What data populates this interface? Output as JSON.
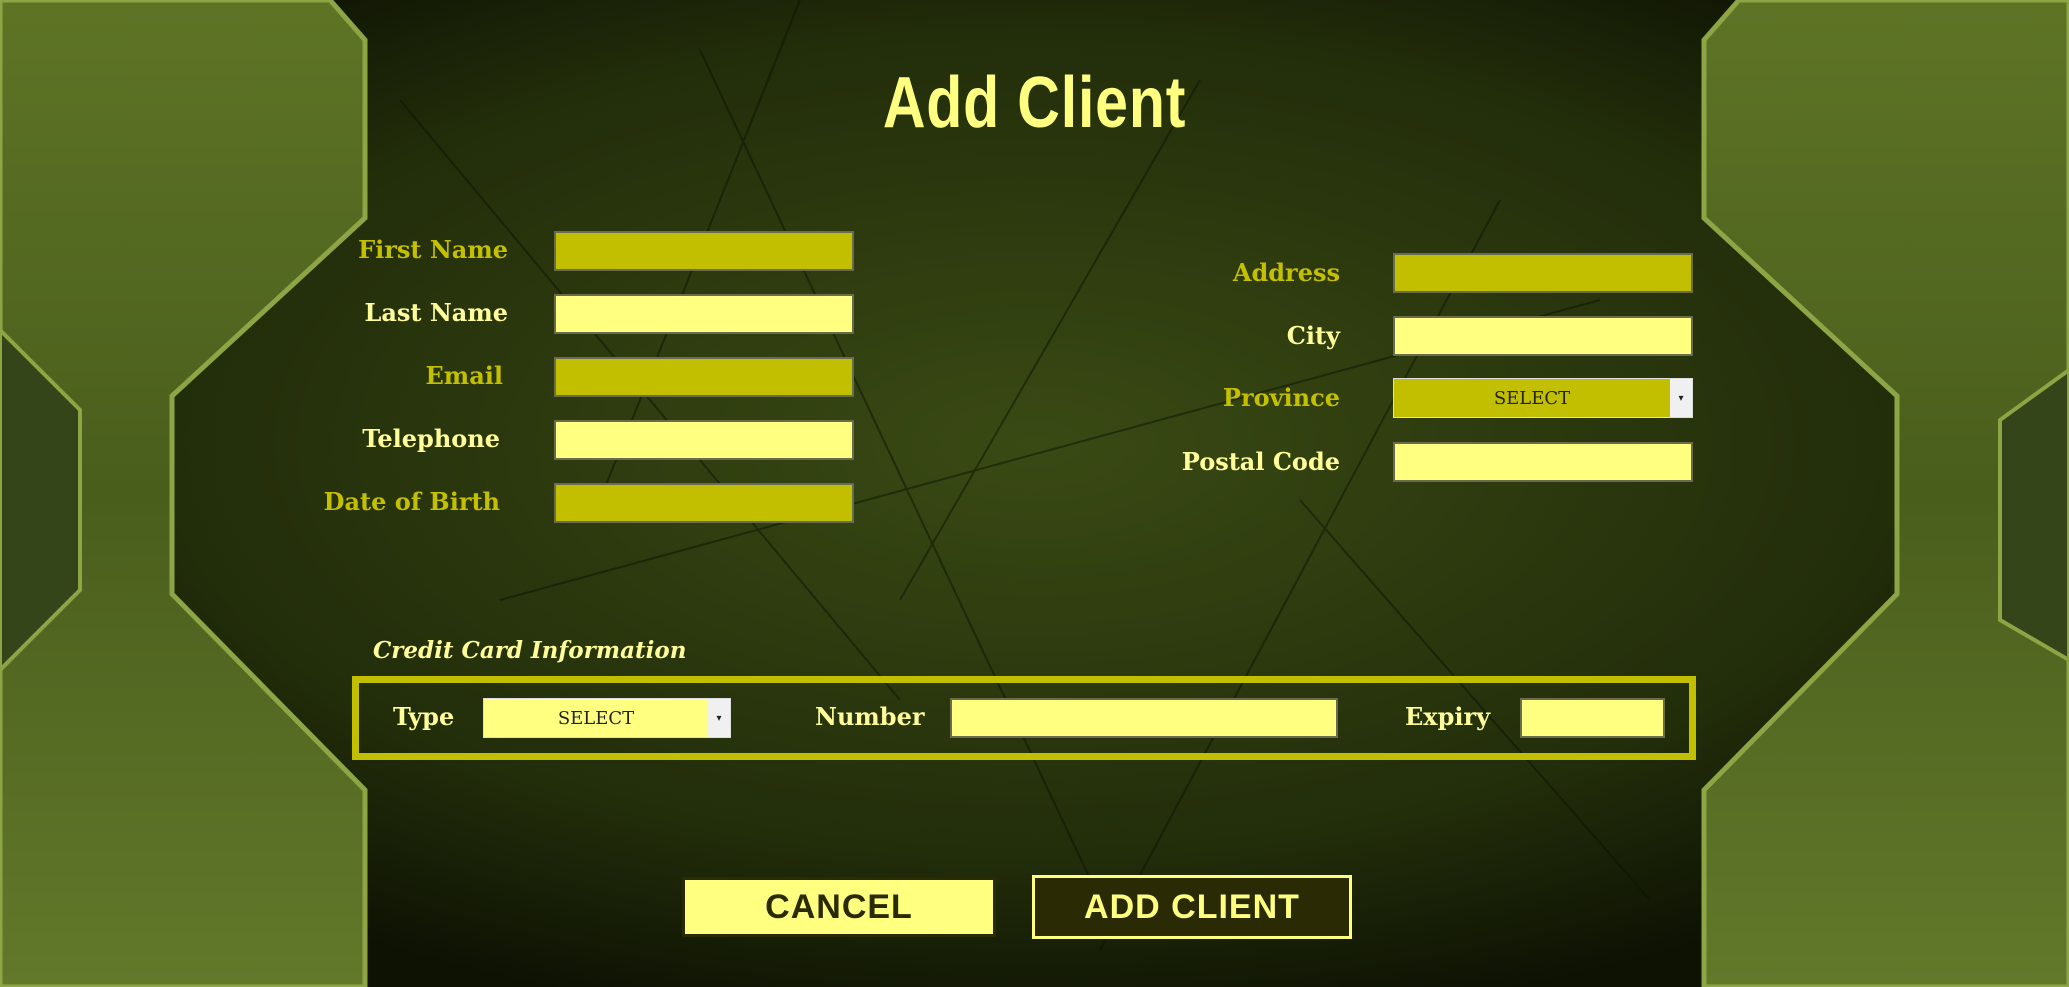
{
  "title": "Add Client",
  "left_fields": [
    {
      "label": "First Name",
      "value": ""
    },
    {
      "label": "Last Name",
      "value": ""
    },
    {
      "label": "Email",
      "value": ""
    },
    {
      "label": "Telephone",
      "value": ""
    },
    {
      "label": "Date of Birth",
      "value": ""
    }
  ],
  "right_fields": {
    "address": {
      "label": "Address",
      "value": ""
    },
    "city": {
      "label": "City",
      "value": ""
    },
    "province": {
      "label": "Province",
      "selected": "SELECT"
    },
    "postal": {
      "label": "Postal Code",
      "value": ""
    }
  },
  "credit_card": {
    "heading": "Credit Card Information",
    "type_label": "Type",
    "type_selected": "SELECT",
    "number_label": "Number",
    "number_value": "",
    "expiry_label": "Expiry",
    "expiry_value": ""
  },
  "buttons": {
    "cancel": "CANCEL",
    "add": "ADD CLIENT"
  },
  "icons": {
    "dropdown": "▾"
  },
  "colors": {
    "olive": "#c2bf00",
    "cream": "#ffff80",
    "dark": "#2a2a05"
  }
}
